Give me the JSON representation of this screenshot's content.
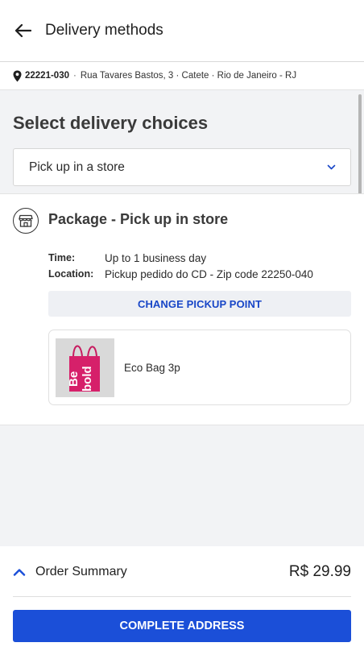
{
  "header": {
    "title": "Delivery methods",
    "back_icon": "arrow-left-icon"
  },
  "address": {
    "zip": "22221-030",
    "separator": "·",
    "street": "Rua Tavares Bastos, 3 · Catete · Rio de Janeiro - RJ",
    "icon": "map-pin-icon"
  },
  "delivery": {
    "section_title": "Select delivery choices",
    "selected_option": "Pick up in a store",
    "dropdown_icon": "chevron-down-icon"
  },
  "package": {
    "title": "Package - Pick up in store",
    "icon": "store-icon",
    "time_label": "Time:",
    "time_value": "Up to 1 business day",
    "location_label": "Location:",
    "location_value": "Pickup pedido do CD - Zip code 22250-040",
    "change_button": "CHANGE PICKUP POINT",
    "items": [
      {
        "name": "Eco Bag 3p",
        "thumb_text": "Be bold"
      }
    ]
  },
  "footer": {
    "summary_label": "Order Summary",
    "summary_icon": "chevron-up-icon",
    "total": "R$ 29.99",
    "complete_button": "COMPLETE ADDRESS"
  },
  "colors": {
    "accent": "#1b4fd8",
    "link": "#1846c7",
    "background": "#f2f3f5",
    "bag": "#d6206a"
  }
}
